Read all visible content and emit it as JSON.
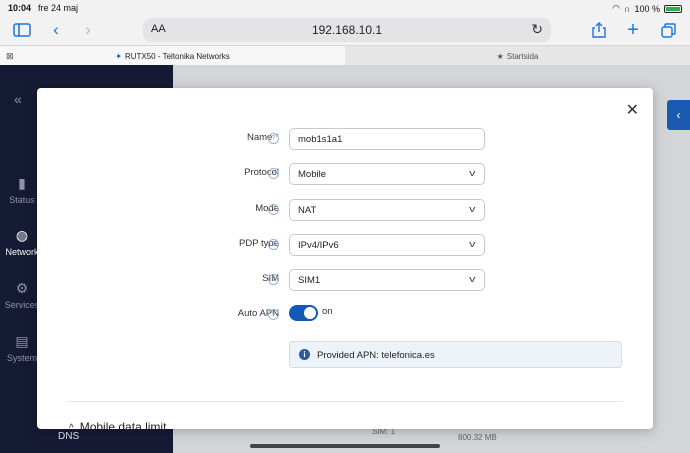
{
  "status_bar": {
    "time": "10:04",
    "date": "fre 24 maj",
    "battery": "100 %"
  },
  "browser": {
    "text_size_label": "AA",
    "url": "192.168.10.1",
    "tabs": [
      {
        "label": "RUTX50 - Teltonika Networks",
        "active": true
      },
      {
        "label": "Startsida",
        "active": false
      }
    ]
  },
  "sidebar": {
    "items": [
      {
        "label": "Status",
        "icon": "bar-chart-icon"
      },
      {
        "label": "Network",
        "icon": "globe-icon"
      },
      {
        "label": "Services",
        "icon": "gear-icon"
      },
      {
        "label": "System",
        "icon": "document-icon"
      }
    ],
    "sub_item": "DNS"
  },
  "background": {
    "sim_text": "SIM: 1",
    "data_text": "800.32 MB"
  },
  "form": {
    "name": {
      "label": "Name",
      "value": "mob1s1a1",
      "required": true
    },
    "protocol": {
      "label": "Protocol",
      "value": "Mobile"
    },
    "mode": {
      "label": "Mode",
      "value": "NAT"
    },
    "pdp_type": {
      "label": "PDP type",
      "value": "IPv4/IPv6"
    },
    "sim": {
      "label": "SIM",
      "value": "SIM1"
    },
    "auto_apn": {
      "label": "Auto APN",
      "state": "on",
      "enabled": true
    },
    "info": "Provided APN: telefonica.es",
    "section_title": "Mobile data limit"
  },
  "colors": {
    "accent": "#1658b8",
    "sidebar": "#161b35",
    "required": "#e03a3a"
  }
}
